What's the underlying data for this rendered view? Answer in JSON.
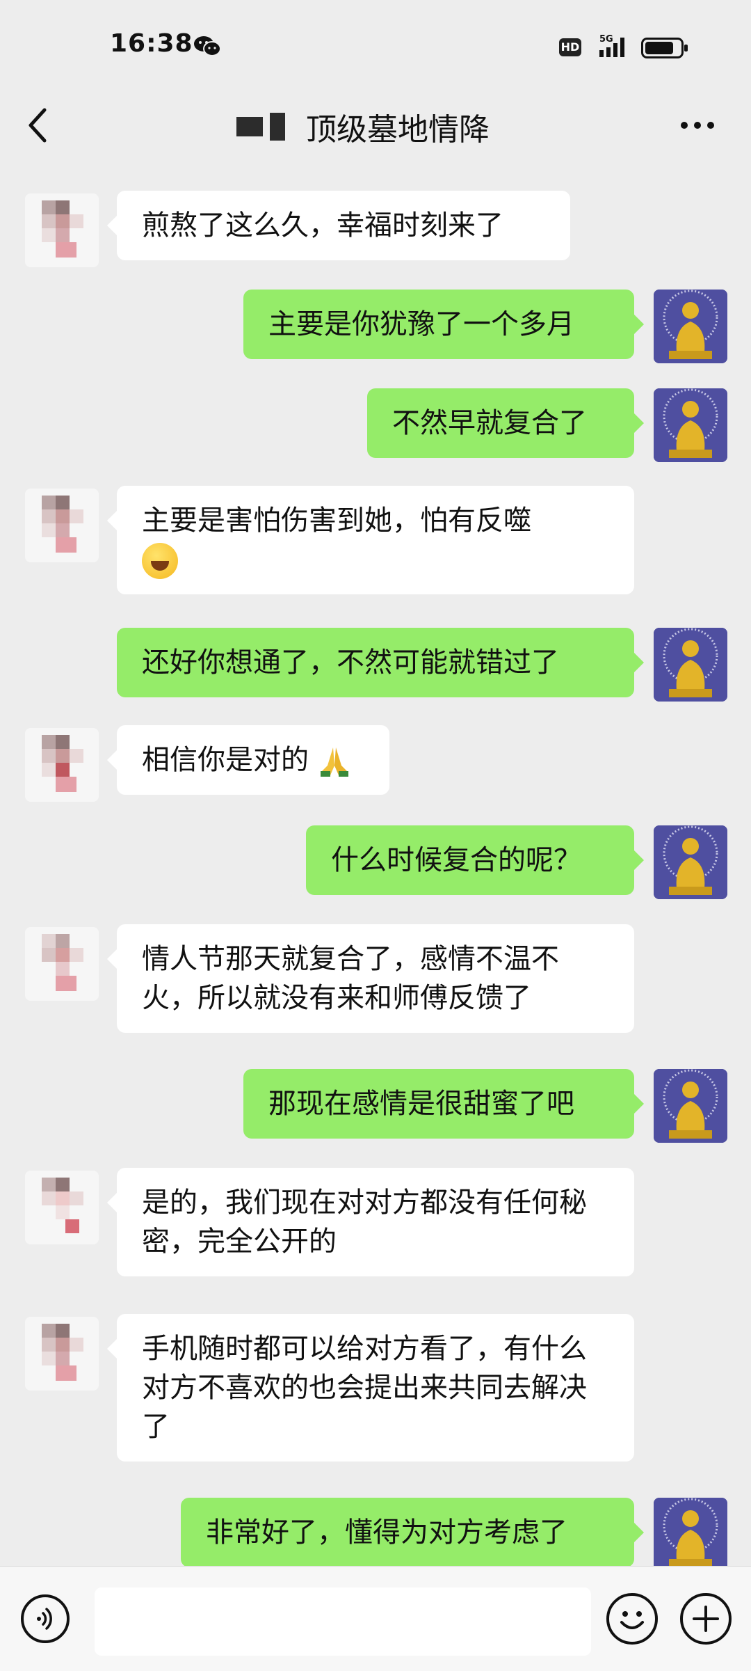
{
  "status_bar": {
    "time": "16:38",
    "app_icon": "wechat-icon",
    "hd_label": "HD",
    "network_label": "5G"
  },
  "header": {
    "title": "顶级墓地情降",
    "back_icon": "chevron-left-icon",
    "more_icon": "more-dots-icon"
  },
  "messages": [
    {
      "side": "left",
      "text": "煎熬了这么久，幸福时刻来了"
    },
    {
      "side": "right",
      "text": "主要是你犹豫了一个多月"
    },
    {
      "side": "right",
      "text": "不然早就复合了"
    },
    {
      "side": "left",
      "text": "主要是害怕伤害到她，怕有反噬",
      "emoji": "rolling-laugh-emoji"
    },
    {
      "side": "right",
      "text": "还好你想通了，不然可能就错过了"
    },
    {
      "side": "left",
      "text": "相信你是对的",
      "emoji": "pray-emoji"
    },
    {
      "side": "right",
      "text": "什么时候复合的呢？"
    },
    {
      "side": "left",
      "text": "情人节那天就复合了，感情不温不火，所以就没有来和师傅反馈了"
    },
    {
      "side": "right",
      "text": "那现在感情是很甜蜜了吧"
    },
    {
      "side": "left",
      "text": "是的，我们现在对对方都没有任何秘密，完全公开的"
    },
    {
      "side": "left",
      "text": "手机随时都可以给对方看了，有什么对方不喜欢的也会提出来共同去解决了"
    },
    {
      "side": "right",
      "text": "非常好了，懂得为对方考虑了"
    }
  ],
  "input_bar": {
    "voice_icon": "voice-icon",
    "emoji_icon": "smiley-icon",
    "add_icon": "plus-icon"
  },
  "colors": {
    "background": "#ededed",
    "bubble_sent": "#95ec69",
    "bubble_received": "#ffffff"
  }
}
